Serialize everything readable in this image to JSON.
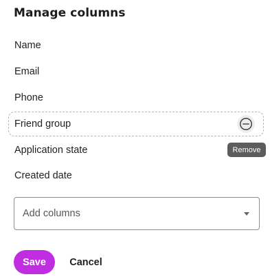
{
  "dialog": {
    "title": "Manage columns"
  },
  "columns": [
    {
      "label": "Name"
    },
    {
      "label": "Email"
    },
    {
      "label": "Phone"
    },
    {
      "label": "Friend group",
      "hovered": true
    },
    {
      "label": "Application state"
    },
    {
      "label": "Created date"
    }
  ],
  "remove": {
    "icon": "minus-circle-icon",
    "tooltip": "Remove"
  },
  "add_columns": {
    "placeholder": "Add columns",
    "icon": "chevron-down-icon"
  },
  "actions": {
    "save_label": "Save",
    "cancel_label": "Cancel"
  },
  "colors": {
    "primary": "#c12de0",
    "tooltip_bg": "#5c5c5c"
  }
}
